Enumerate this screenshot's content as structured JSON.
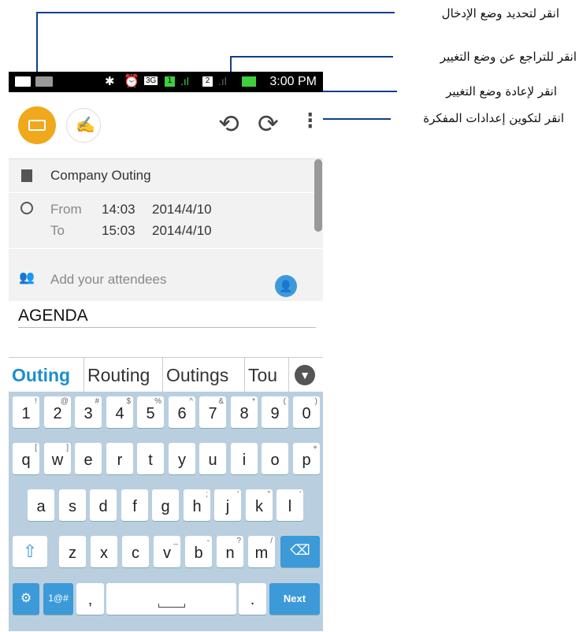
{
  "callouts": [
    {
      "id": "input-mode",
      "text": "انقر لتحديد وضع الإدخال"
    },
    {
      "id": "undo",
      "text": "انقر للتراجع عن وضع التغيير"
    },
    {
      "id": "redo",
      "text": "انقر لإعادة وضع التغيير"
    },
    {
      "id": "settings",
      "text": "انقر لتكوين إعدادات المفكرة"
    }
  ],
  "status_bar": {
    "time": "3:00 PM",
    "network": "3G",
    "sim1": "1",
    "sim2": "2"
  },
  "event": {
    "title": "Company Outing",
    "from_label": "From",
    "from_time": "14:03",
    "from_date": "2014/4/10",
    "to_label": "To",
    "to_time": "15:03",
    "to_date": "2014/4/10",
    "attendees_placeholder": "Add your attendees",
    "notes_text": "AGENDA"
  },
  "suggestions": [
    "Outing",
    "Routing",
    "Outings",
    "Tou"
  ],
  "keyboard": {
    "row1": [
      {
        "k": "1",
        "s": "!"
      },
      {
        "k": "2",
        "s": "@"
      },
      {
        "k": "3",
        "s": "#"
      },
      {
        "k": "4",
        "s": "$"
      },
      {
        "k": "5",
        "s": "%"
      },
      {
        "k": "6",
        "s": "^"
      },
      {
        "k": "7",
        "s": "&"
      },
      {
        "k": "8",
        "s": "*"
      },
      {
        "k": "9",
        "s": "("
      },
      {
        "k": "0",
        "s": ")"
      }
    ],
    "row2": [
      {
        "k": "q",
        "s": "["
      },
      {
        "k": "w",
        "s": "]"
      },
      {
        "k": "e",
        "s": ""
      },
      {
        "k": "r",
        "s": ""
      },
      {
        "k": "t",
        "s": ""
      },
      {
        "k": "y",
        "s": ""
      },
      {
        "k": "u",
        "s": ""
      },
      {
        "k": "i",
        "s": ""
      },
      {
        "k": "o",
        "s": ""
      },
      {
        "k": "p",
        "s": "+"
      }
    ],
    "row3": [
      {
        "k": "a",
        "s": ""
      },
      {
        "k": "s",
        "s": ""
      },
      {
        "k": "d",
        "s": ""
      },
      {
        "k": "f",
        "s": ""
      },
      {
        "k": "g",
        "s": ""
      },
      {
        "k": "h",
        "s": ";"
      },
      {
        "k": "j",
        "s": "'"
      },
      {
        "k": "k",
        "s": "\""
      },
      {
        "k": "l",
        "s": "'"
      }
    ],
    "row4": [
      {
        "k": "z",
        "s": ""
      },
      {
        "k": "x",
        "s": ""
      },
      {
        "k": "c",
        "s": ""
      },
      {
        "k": "v",
        "s": "_"
      },
      {
        "k": "b",
        "s": "-"
      },
      {
        "k": "n",
        "s": "?"
      },
      {
        "k": "m",
        "s": "/"
      }
    ],
    "symbols_label": "1@#",
    "comma_label": ",",
    "period_label": ".",
    "next_label": "Next"
  },
  "colors": {
    "accent": "#f0a81c",
    "callout_line": "#0d3f8a",
    "keyboard_bg": "#b9cfe0",
    "key_blue": "#3c9ad9",
    "suggest_active": "#1a8fd0"
  }
}
